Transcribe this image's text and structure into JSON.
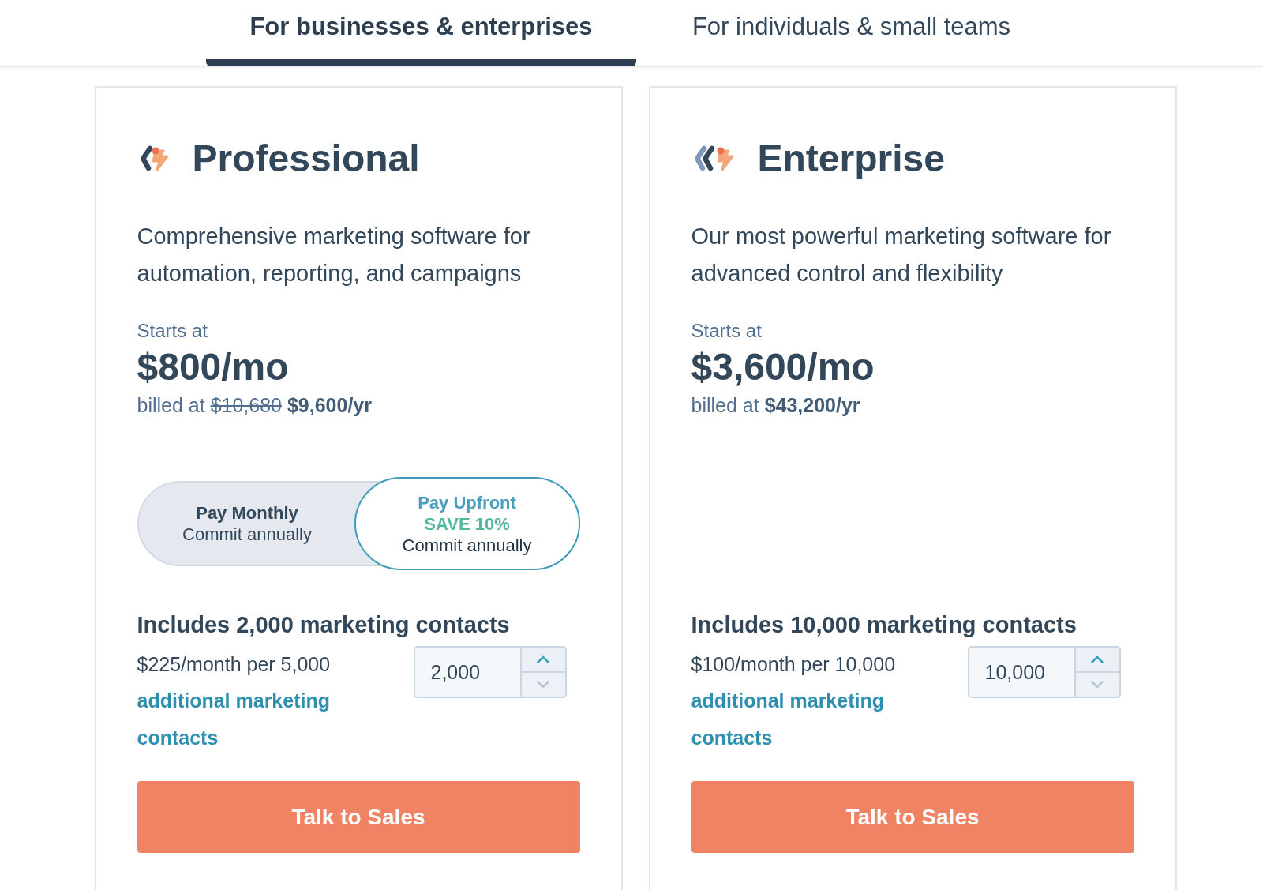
{
  "tabs": [
    {
      "label": "For businesses & enterprises",
      "selected": true
    },
    {
      "label": "For individuals & small teams",
      "selected": false
    }
  ],
  "plans": [
    {
      "name": "Professional",
      "description": "Comprehensive marketing software for automation, reporting, and campaigns",
      "price_label": "Starts at",
      "price": "$800/mo",
      "billing": {
        "label": "billed at",
        "original_price": "$10,680",
        "price": "$9,600/yr"
      },
      "payment_options": [
        {
          "title": "Pay Monthly",
          "note": "Commit annually",
          "selected": false
        },
        {
          "title": "Pay Upfront",
          "badge": "SAVE 10%",
          "note": "Commit annually",
          "selected": true
        }
      ],
      "contacts": {
        "heading": "Includes 2,000 marketing contacts",
        "rate": "$225/month per 5,000",
        "link": "additional marketing contacts",
        "value": "2,000",
        "stepper": [
          {
            "kind": "increase",
            "disabled": false
          },
          {
            "kind": "decrease",
            "disabled": true
          }
        ]
      },
      "button": "Talk to Sales"
    },
    {
      "name": "Enterprise",
      "description": "Our most powerful marketing software for advanced control and flexibility",
      "price_label": "Starts at",
      "price": "$3,600/mo",
      "billing": {
        "label": "billed at",
        "price": "$43,200/yr"
      },
      "contacts": {
        "heading": "Includes 10,000 marketing contacts",
        "rate": "$100/month per 10,000",
        "link": "additional marketing contacts",
        "value": "10,000",
        "stepper": [
          {
            "kind": "increase",
            "disabled": false
          },
          {
            "kind": "decrease",
            "disabled": true
          }
        ]
      },
      "button": "Talk to Sales"
    }
  ]
}
